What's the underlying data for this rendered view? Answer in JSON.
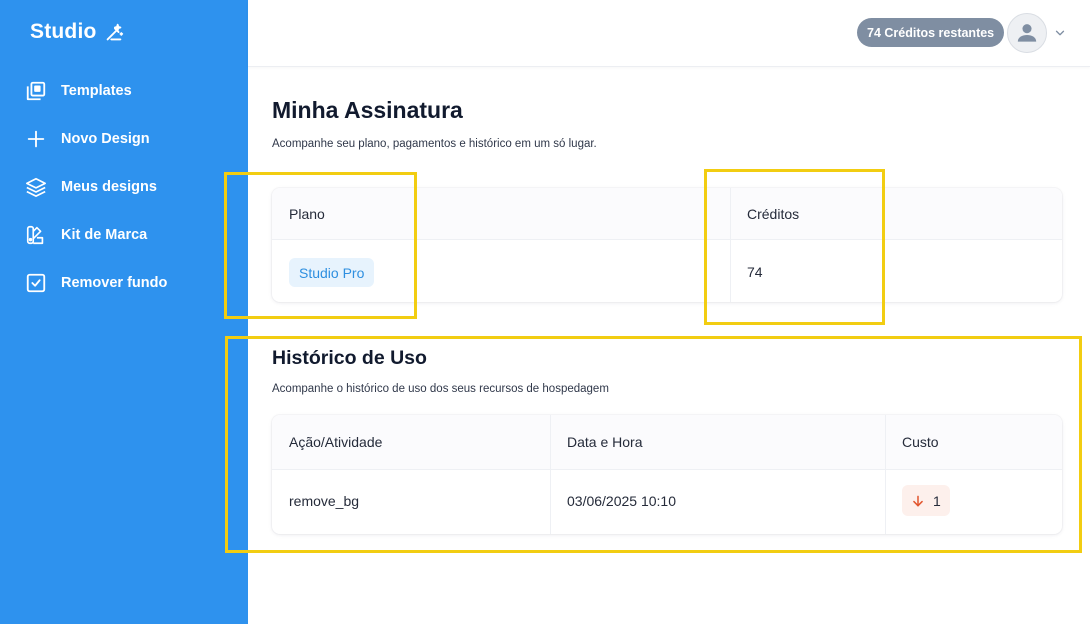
{
  "sidebar": {
    "brand": "Studio",
    "items": [
      {
        "label": "Templates",
        "icon": "templates-icon"
      },
      {
        "label": "Novo Design",
        "icon": "plus-icon"
      },
      {
        "label": "Meus designs",
        "icon": "layers-icon"
      },
      {
        "label": "Kit de Marca",
        "icon": "brand-kit-icon"
      },
      {
        "label": "Remover fundo",
        "icon": "checkbox-icon"
      }
    ]
  },
  "topbar": {
    "credits_label": "74 Créditos restantes"
  },
  "page": {
    "title": "Minha Assinatura",
    "subtitle": "Acompanhe seu plano, pagamentos e histórico em um só lugar."
  },
  "plan": {
    "headers": {
      "plan": "Plano",
      "credits": "Créditos"
    },
    "plan_name": "Studio Pro",
    "credits": "74"
  },
  "history": {
    "title": "Histórico de Uso",
    "subtitle": "Acompanhe o histórico de uso dos seus recursos de hospedagem",
    "headers": {
      "action": "Ação/Atividade",
      "datetime": "Data e Hora",
      "cost": "Custo"
    },
    "rows": [
      {
        "action": "remove_bg",
        "datetime": "03/06/2025 10:10",
        "cost": "1"
      }
    ]
  },
  "colors": {
    "sidebar": "#2e92ee",
    "highlight": "#f2cd11",
    "plan_badge_bg": "#e7f3fd",
    "cost_badge_bg": "#fdf0ec",
    "cost_arrow": "#e2562f"
  }
}
